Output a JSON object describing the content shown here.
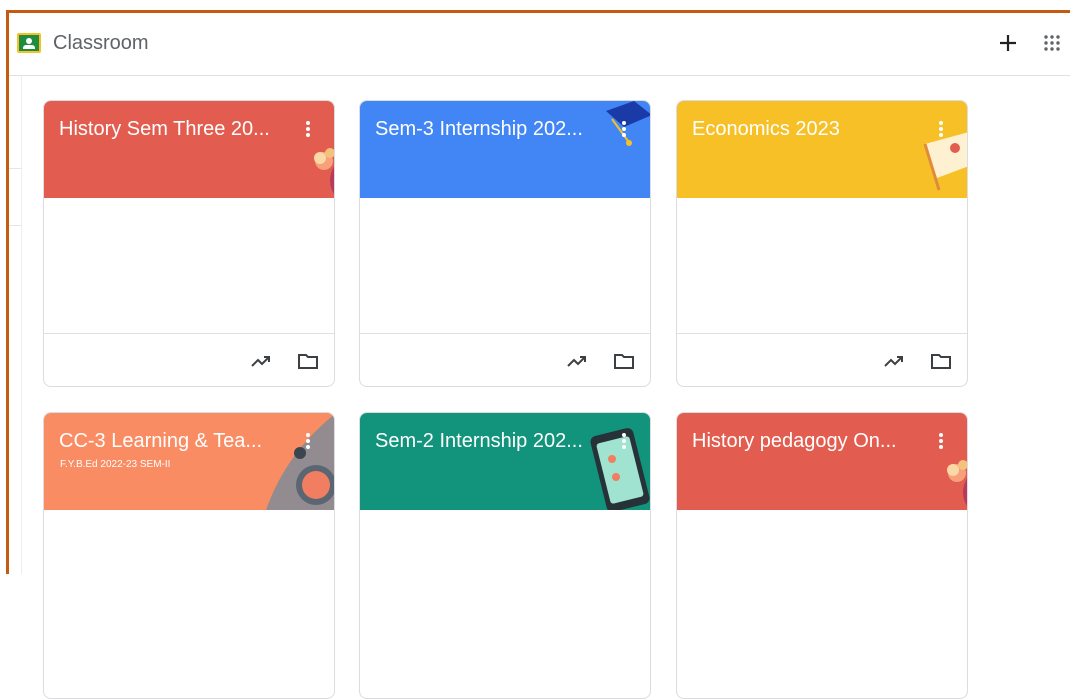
{
  "app": {
    "title": "Classroom"
  },
  "header": {
    "plus_icon": "plus-icon",
    "apps_icon": "apps-grid-icon"
  },
  "colors": {
    "frame": "#c55a11",
    "red": "#e25d4f",
    "blue": "#4285f4",
    "yellow": "#f6c026",
    "salmon": "#fa8c64",
    "teal": "#12947c"
  },
  "cards": [
    {
      "title": "History Sem Three 20...",
      "subtitle": "",
      "color": "#e25d4f"
    },
    {
      "title": "Sem-3 Internship 202...",
      "subtitle": "",
      "color": "#4285f4"
    },
    {
      "title": "Economics 2023",
      "subtitle": "",
      "color": "#f6c026"
    },
    {
      "title": "CC-3 Learning & Tea...",
      "subtitle": "F.Y.B.Ed 2022-23 SEM-II",
      "color": "#fa8c64"
    },
    {
      "title": "Sem-2 Internship 202...",
      "subtitle": "",
      "color": "#12947c"
    },
    {
      "title": "History pedagogy On...",
      "subtitle": "",
      "color": "#e25d4f"
    }
  ],
  "card_icons": {
    "menu": "more-vert-icon",
    "trend": "trending-up-icon",
    "folder": "folder-icon"
  }
}
